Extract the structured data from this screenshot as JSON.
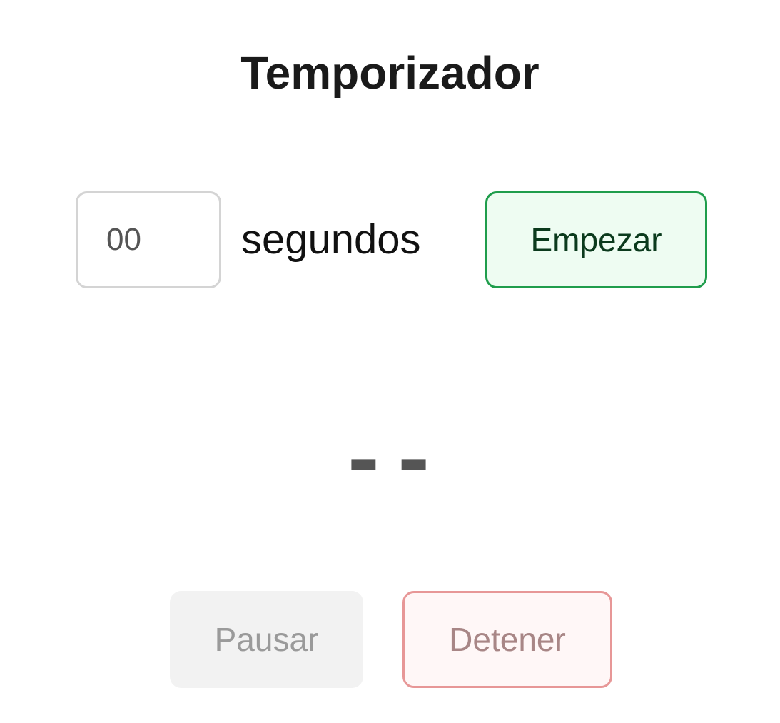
{
  "app": {
    "title": "Temporizador"
  },
  "timer_input": {
    "value": "",
    "placeholder": "00",
    "unit_label": "segundos"
  },
  "controls": {
    "start_label": "Empezar",
    "pause_label": "Pausar",
    "stop_label": "Detener",
    "pause_enabled": false,
    "stop_enabled": false
  },
  "display": {
    "text": "--"
  },
  "colors": {
    "start_border": "#1f9d4c",
    "start_background": "#eefcf2",
    "stop_border": "#e79797",
    "stop_background": "#fff7f7",
    "pause_background": "#f2f2f2"
  }
}
